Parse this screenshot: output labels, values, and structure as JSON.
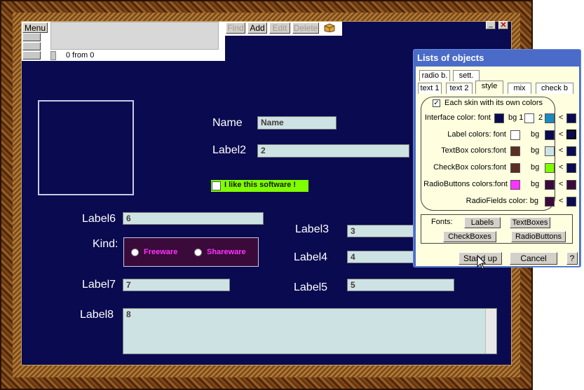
{
  "toolbar": {
    "menu_label": "Menu",
    "counter_text": "0 from 0",
    "find_label": "Find",
    "add_label": "Add",
    "edit_label": "Edit",
    "delete_label": "Delete"
  },
  "form": {
    "name_label": "Name",
    "name_value": "Name",
    "label2": "Label2",
    "label2_value": "2",
    "checkbox_label": "I like this software !",
    "label6": "Label6",
    "label6_value": "6",
    "kind_label": "Kind:",
    "radio_freeware": "Freeware",
    "radio_shareware": "Shareware",
    "label7": "Label7",
    "label7_value": "7",
    "label3": "Label3",
    "label3_value": "3",
    "label4": "Label4",
    "label4_value": "4",
    "label5": "Label5",
    "label5_value": "5",
    "label8": "Label8",
    "label8_value": "8"
  },
  "dialog": {
    "title": "Lists of objects",
    "tabs_row1": [
      "radio b.",
      "sett."
    ],
    "tabs_row2": [
      "text 1",
      "text 2",
      "style",
      "mix",
      "check b"
    ],
    "active_tab": "style",
    "own_colors_checkbox": "Each skin with its own colors",
    "interface_color": "Interface color: font",
    "bg1": "bg 1",
    "two": "2",
    "label_colors": "Label colors: font",
    "textbox_colors": "TextBox colors:font",
    "checkbox_colors": "CheckBox colors:font",
    "radio_colors": "RadioButtons colors:font",
    "radiofields_color": "RadioFields color: bg",
    "bg": "bg",
    "arrow": "<",
    "fonts_label": "Fonts:",
    "font_labels_btn": "Labels",
    "font_textboxes_btn": "TextBoxes",
    "font_checkboxes_btn": "CheckBoxes",
    "font_radiobuttons_btn": "RadioButtons",
    "standup_btn": "Stand up",
    "cancel_btn": "Cancel",
    "help_btn": "?"
  },
  "colors": {
    "canvas_bg": "#0a0a50",
    "checkbox_bg": "#7fff00",
    "radio_text": "#ff33ff",
    "radio_field_bg": "#3a0a3a"
  }
}
